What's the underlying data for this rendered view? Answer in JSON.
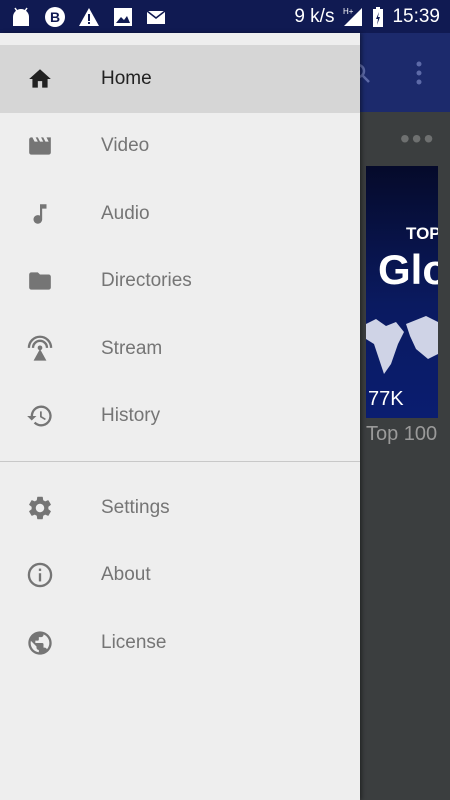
{
  "status_bar": {
    "speed": "9 k/s",
    "network": "H+",
    "time": "15:39",
    "icons": [
      "android-icon",
      "bitcoin-icon",
      "warning-icon",
      "image-icon",
      "mail-icon",
      "signal-icon",
      "battery-icon"
    ]
  },
  "drawer": {
    "primary_items": [
      {
        "label": "Home",
        "icon": "home-icon",
        "selected": true
      },
      {
        "label": "Video",
        "icon": "movie-icon",
        "selected": false
      },
      {
        "label": "Audio",
        "icon": "music-note-icon",
        "selected": false
      },
      {
        "label": "Directories",
        "icon": "folder-icon",
        "selected": false
      },
      {
        "label": "Stream",
        "icon": "broadcast-icon",
        "selected": false
      },
      {
        "label": "History",
        "icon": "history-icon",
        "selected": false
      }
    ],
    "secondary_items": [
      {
        "label": "Settings",
        "icon": "gear-icon"
      },
      {
        "label": "About",
        "icon": "info-icon"
      },
      {
        "label": "License",
        "icon": "globe-icon"
      }
    ]
  },
  "background": {
    "thumb_title_small": "TOP",
    "thumb_title_large": "Glo",
    "thumb_count": "77K",
    "caption": "Top 100"
  },
  "colors": {
    "status_bar": "#101a52",
    "toolbar": "#1c2a6c",
    "drawer_bg": "#eeeeee",
    "selected_bg": "#d6d6d6",
    "icon_grey": "#757575"
  }
}
